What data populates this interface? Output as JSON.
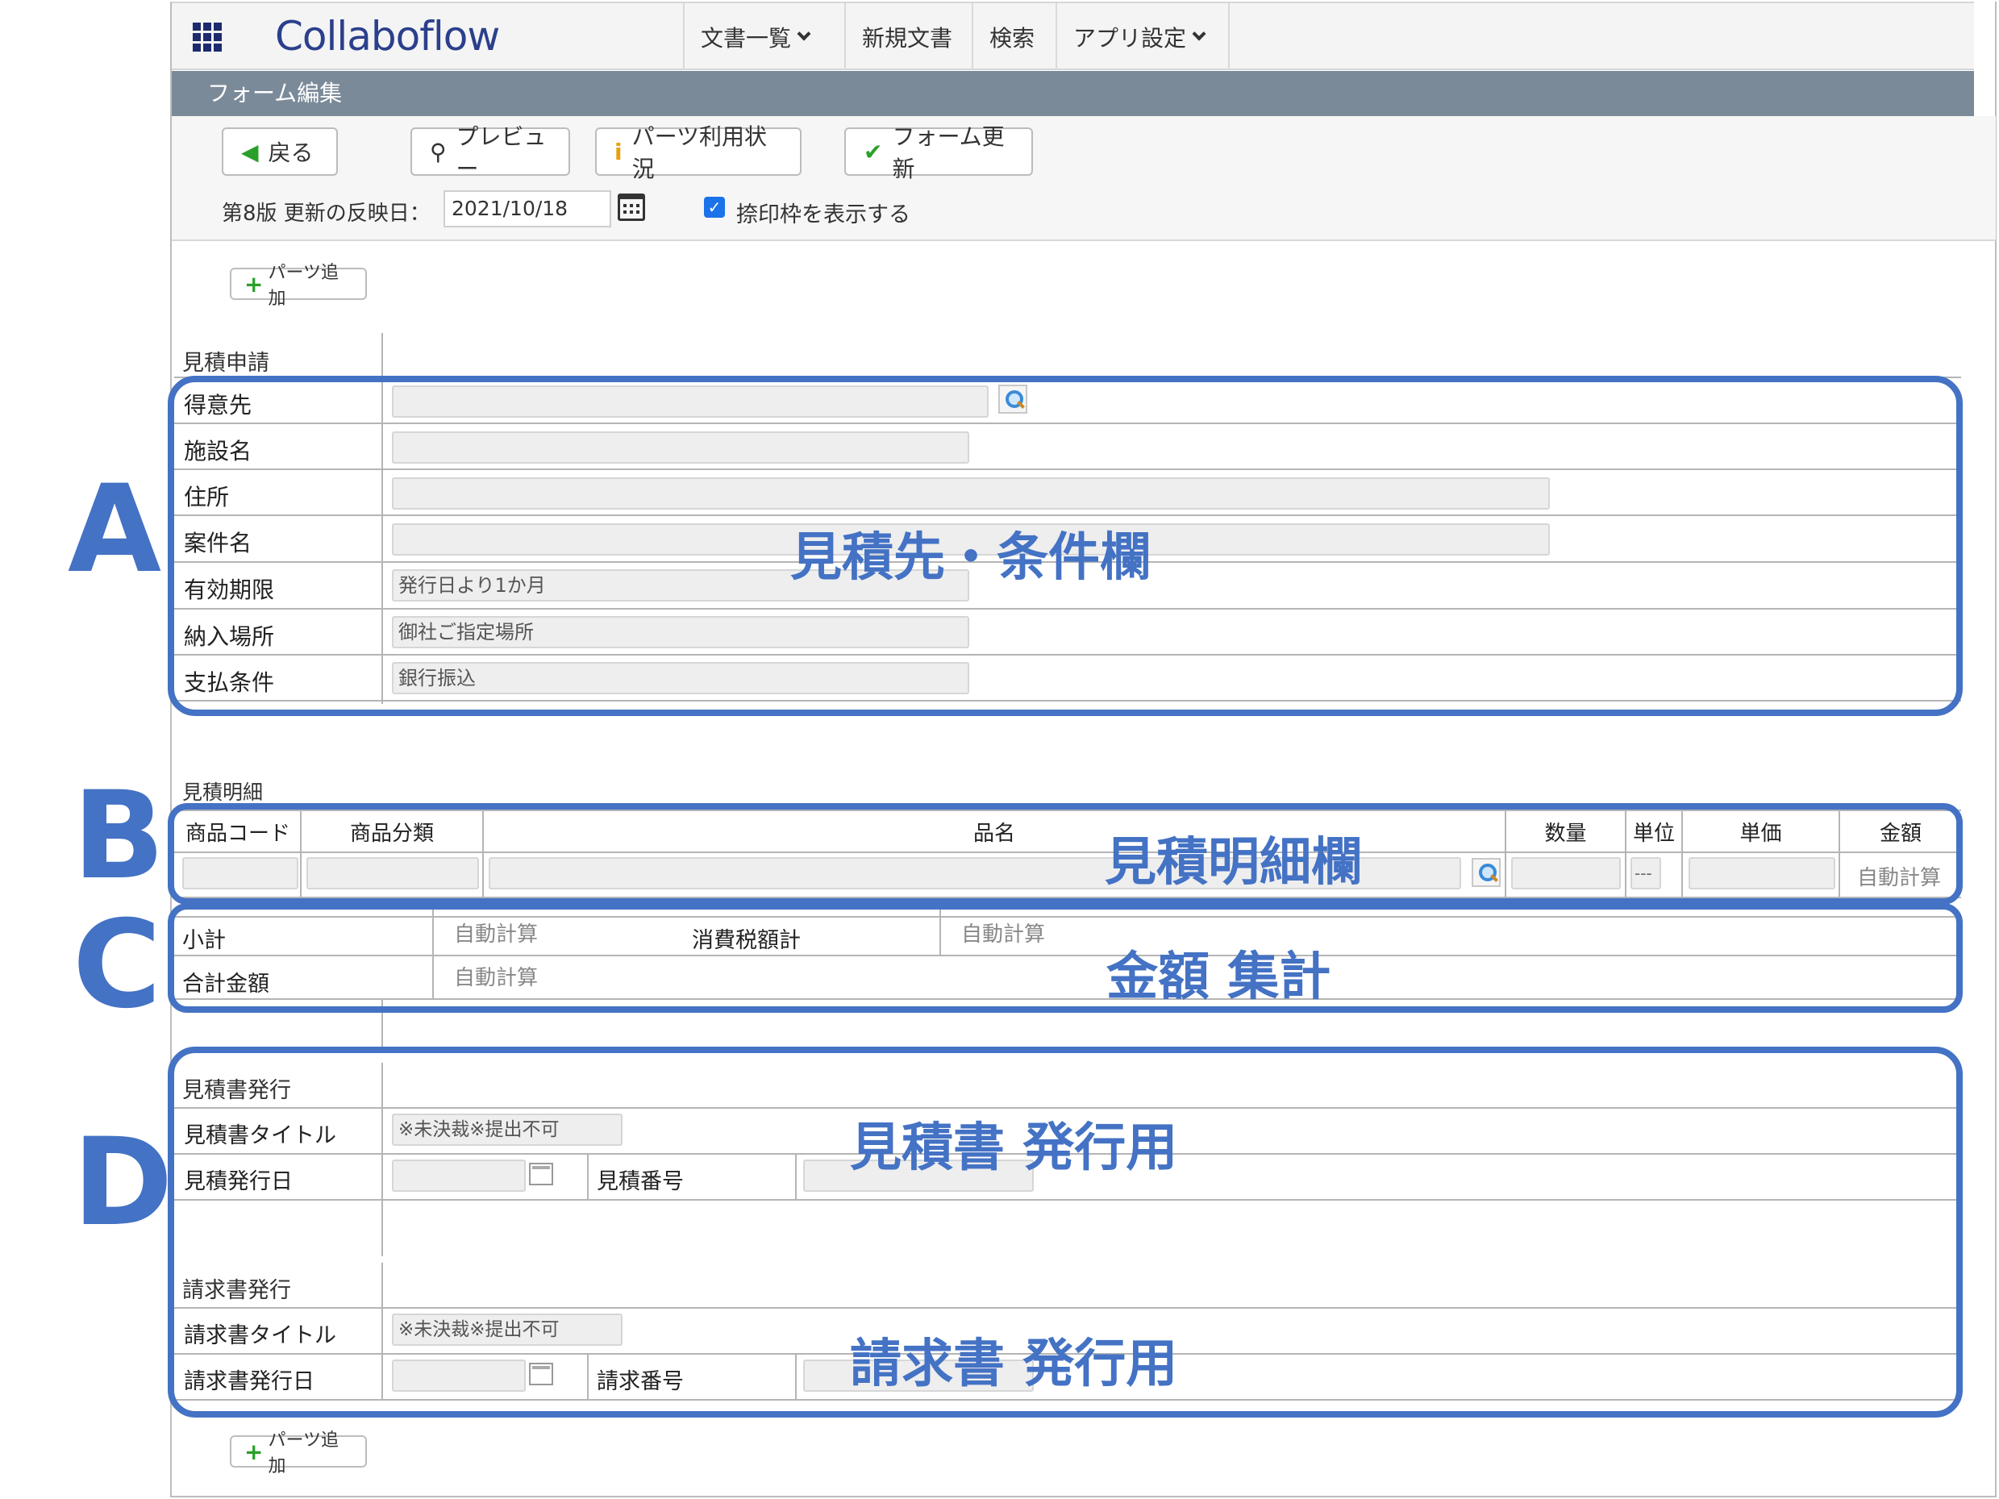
{
  "app": {
    "logo": "Collaboflow"
  },
  "nav": {
    "items": [
      {
        "label": "文書一覧",
        "has_dropdown": true
      },
      {
        "label": "新規文書",
        "has_dropdown": false
      },
      {
        "label": "検索",
        "has_dropdown": false
      },
      {
        "label": "アプリ設定",
        "has_dropdown": true
      }
    ],
    "menu_icon": "grid-icon"
  },
  "titlebar": {
    "title": "フォーム編集"
  },
  "toolbar": {
    "back": "戻る",
    "preview": "プレビュー",
    "parts_usage": "パーツ利用状況",
    "update": "フォーム更新",
    "version_label": "第8版 更新の反映日：",
    "date_value": "2021/10/18",
    "stamp_checkbox_label": "捺印枠を表示する",
    "stamp_checked": true
  },
  "add_parts": "パーツ追加",
  "section_a": {
    "title": "見積申請",
    "rows": [
      {
        "label": "得意先",
        "value": ""
      },
      {
        "label": "施設名",
        "value": ""
      },
      {
        "label": "住所",
        "value": ""
      },
      {
        "label": "案件名",
        "value": ""
      },
      {
        "label": "有効期限",
        "value": "発行日より1か月"
      },
      {
        "label": "納入場所",
        "value": "御社ご指定場所"
      },
      {
        "label": "支払条件",
        "value": "銀行振込"
      }
    ]
  },
  "section_b": {
    "title": "見積明細",
    "columns": [
      "商品コード",
      "商品分類",
      "品名",
      "数量",
      "単位",
      "単価",
      "金額"
    ],
    "unit_placeholder": "---",
    "amount_auto": "自動計算"
  },
  "section_c": {
    "subtotal_label": "小計",
    "subtotal_value": "自動計算",
    "tax_label": "消費税額計",
    "tax_value": "自動計算",
    "total_label": "合計金額",
    "total_value": "自動計算"
  },
  "section_d": {
    "quote_title": "見積書発行",
    "quote_doc_title_label": "見積書タイトル",
    "quote_doc_title_value": "※未決裁※提出不可",
    "quote_date_label": "見積発行日",
    "quote_number_label": "見積番号",
    "invoice_title": "請求書発行",
    "invoice_doc_title_label": "請求書タイトル",
    "invoice_doc_title_value": "※未決裁※提出不可",
    "invoice_date_label": "請求書発行日",
    "invoice_number_label": "請求番号"
  },
  "annotations": {
    "a_letter": "A",
    "a_text": "見積先・条件欄",
    "b_letter": "B",
    "b_text": "見積明細欄",
    "c_letter": "C",
    "c_text": "金額 集計",
    "d_letter": "D",
    "d_text_1": "見積書 発行用",
    "d_text_2": "請求書 発行用",
    "color": "#4472c4"
  }
}
